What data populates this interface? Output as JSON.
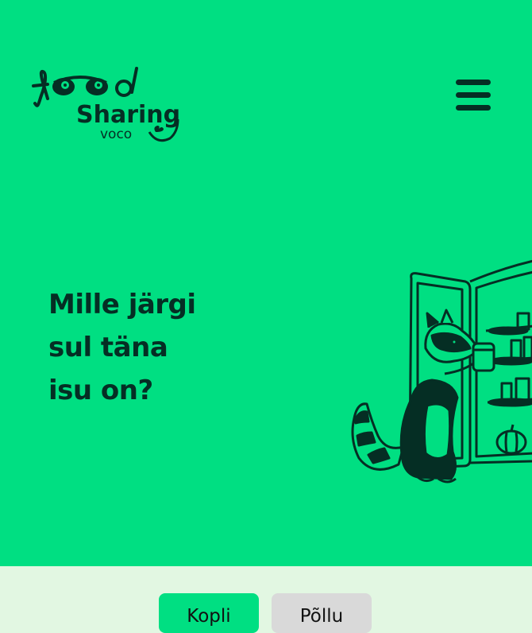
{
  "header": {
    "logo": {
      "line1": "food",
      "line2": "Sharing",
      "line3": "voco"
    },
    "menu_icon": "hamburger-menu-icon"
  },
  "hero": {
    "headline_lines": [
      "Mille järgi",
      "sul täna",
      "isu on?"
    ],
    "illustration": "raccoon-at-fridge"
  },
  "tabs": [
    {
      "label": "Kopli",
      "active": true
    },
    {
      "label": "Põllu",
      "active": false
    }
  ],
  "colors": {
    "brand_green": "#00df82",
    "dark_text": "#052e24",
    "footer_bg": "#e2f7e2",
    "inactive_tab": "#d9d9d9"
  }
}
